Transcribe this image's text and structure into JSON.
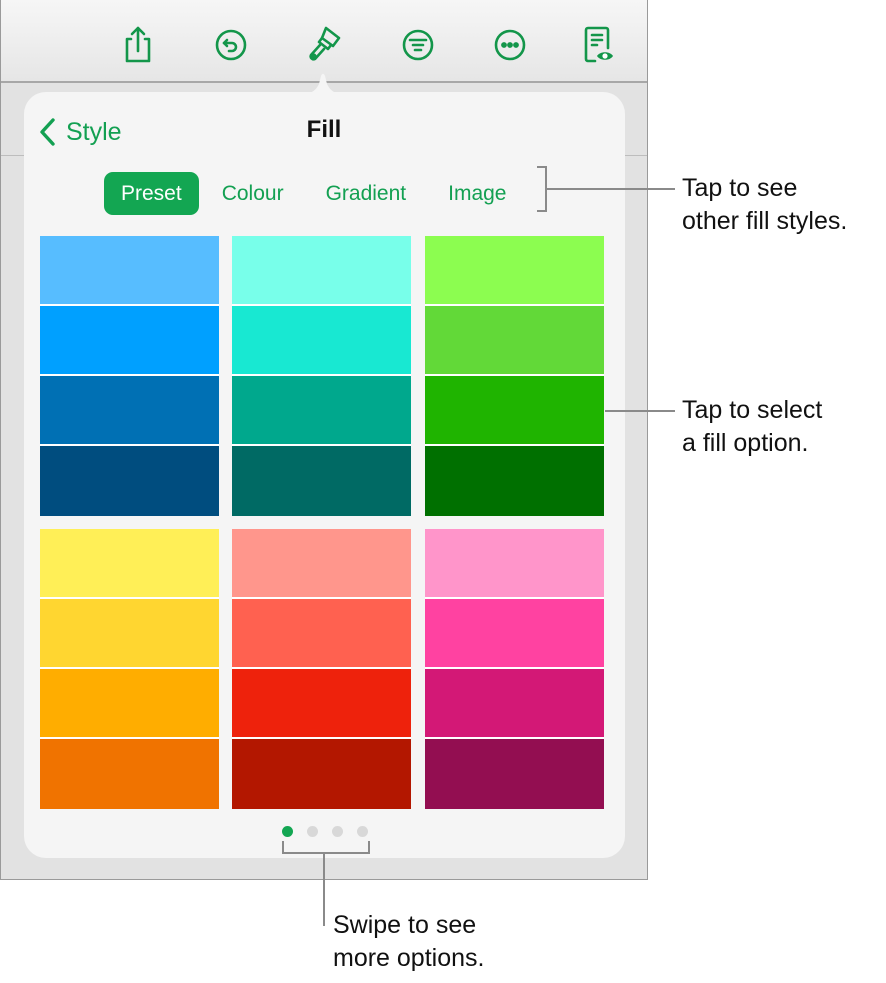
{
  "toolbar": {
    "icons": [
      "share-icon",
      "undo-icon",
      "format-brush-icon",
      "organize-icon",
      "more-icon",
      "reader-view-icon"
    ],
    "accent_color": "#13a052"
  },
  "popover": {
    "back_label": "Style",
    "title": "Fill",
    "tabs": [
      {
        "label": "Preset",
        "active": true
      },
      {
        "label": "Colour",
        "active": false
      },
      {
        "label": "Gradient",
        "active": false
      },
      {
        "label": "Image",
        "active": false
      }
    ],
    "swatches": [
      {
        "name": "blue",
        "colors": [
          "#57bdff",
          "#00a0ff",
          "#0070b4",
          "#004d7f"
        ]
      },
      {
        "name": "teal",
        "colors": [
          "#78ffea",
          "#18e8d2",
          "#00a88d",
          "#006a64"
        ]
      },
      {
        "name": "green",
        "colors": [
          "#8cfd50",
          "#62d938",
          "#1fb400",
          "#007000"
        ]
      },
      {
        "name": "yellow-orange",
        "colors": [
          "#ffef57",
          "#ffd630",
          "#ffad00",
          "#f07300"
        ]
      },
      {
        "name": "red",
        "colors": [
          "#ff968c",
          "#ff6150",
          "#ee220c",
          "#b31700"
        ]
      },
      {
        "name": "pink",
        "colors": [
          "#ff95ca",
          "#ff42a1",
          "#d31876",
          "#930e51"
        ]
      }
    ],
    "page_dots": {
      "count": 4,
      "active_index": 0
    }
  },
  "callouts": {
    "fill_styles": [
      "Tap to see",
      "other fill styles."
    ],
    "select_option": [
      "Tap to select",
      "a fill option."
    ],
    "swipe": [
      "Swipe to see",
      "more options."
    ]
  }
}
